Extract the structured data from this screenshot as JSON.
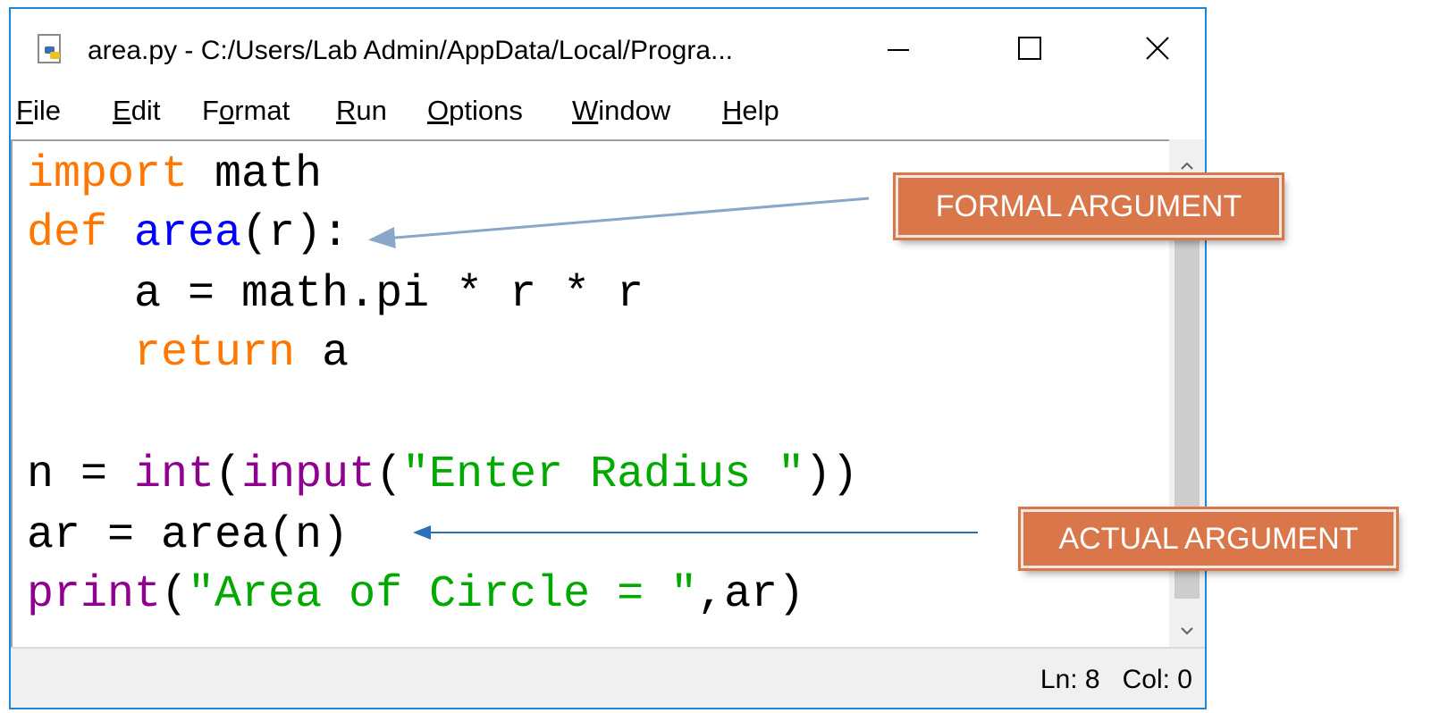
{
  "window": {
    "title": "area.py - C:/Users/Lab Admin/AppData/Local/Progra...",
    "icon": "python-file-icon",
    "controls": [
      "minimize",
      "maximize",
      "close"
    ]
  },
  "menu": [
    {
      "label": "File",
      "mnemonic": "F"
    },
    {
      "label": "Edit",
      "mnemonic": "E"
    },
    {
      "label": "Format",
      "mnemonic": "o"
    },
    {
      "label": "Run",
      "mnemonic": "R"
    },
    {
      "label": "Options",
      "mnemonic": "O"
    },
    {
      "label": "Window",
      "mnemonic": "W"
    },
    {
      "label": "Help",
      "mnemonic": "H"
    }
  ],
  "code": {
    "line1": {
      "kw": "import",
      "rest": " math"
    },
    "line2": {
      "kw": "def",
      "name": "area",
      "rest": "(r):"
    },
    "line3": {
      "text": "    a = math.pi * r * r"
    },
    "line4": {
      "indent": "    ",
      "kw": "return",
      "rest": " a"
    },
    "line6": {
      "a": "n = ",
      "fn1": "int",
      "b": "(",
      "fn2": "input",
      "c": "(",
      "str": "\"Enter Radius \"",
      "d": "))"
    },
    "line7": {
      "text": "ar = area(n)"
    },
    "line8": {
      "fn": "print",
      "a": "(",
      "str": "\"Area of Circle = \"",
      "b": ",ar)"
    }
  },
  "status": {
    "text": "Ln: 8   Col: 0"
  },
  "callouts": {
    "formal": "FORMAL ARGUMENT",
    "actual": "ACTUAL ARGUMENT"
  },
  "colors": {
    "keyword": "#ff7700",
    "builtin": "#900090",
    "definition": "#0000ff",
    "string": "#00aa00",
    "callout_bg": "#d9774b",
    "window_border": "#1e86d8"
  }
}
